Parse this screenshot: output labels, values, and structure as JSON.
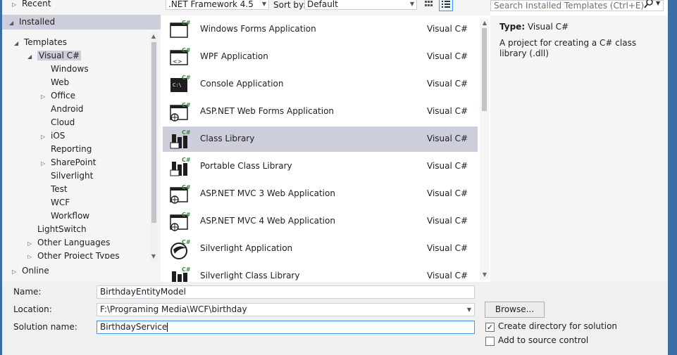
{
  "tree": {
    "recent": "Recent",
    "installed": "Installed",
    "templates": "Templates",
    "visual_csharp": "Visual C#",
    "children": [
      "Windows",
      "Web",
      "Office",
      "Android",
      "Cloud",
      "iOS",
      "Reporting",
      "SharePoint",
      "Silverlight",
      "Test",
      "WCF",
      "Workflow"
    ],
    "lightswitch": "LightSwitch",
    "other_languages": "Other Languages",
    "other_project_types": "Other Project Types",
    "online": "Online"
  },
  "toolbar": {
    "framework": ".NET Framework 4.5",
    "sort_label": "Sort by:",
    "sort_value": "Default",
    "search_placeholder": "Search Installed Templates (Ctrl+E)"
  },
  "templates": [
    {
      "name": "Windows Forms Application",
      "lang": "Visual C#",
      "icon": "windows-forms-icon"
    },
    {
      "name": "WPF Application",
      "lang": "Visual C#",
      "icon": "wpf-icon"
    },
    {
      "name": "Console Application",
      "lang": "Visual C#",
      "icon": "console-icon"
    },
    {
      "name": "ASP.NET Web Forms Application",
      "lang": "Visual C#",
      "icon": "web-forms-icon"
    },
    {
      "name": "Class Library",
      "lang": "Visual C#",
      "icon": "class-library-icon"
    },
    {
      "name": "Portable Class Library",
      "lang": "Visual C#",
      "icon": "portable-library-icon"
    },
    {
      "name": "ASP.NET MVC 3 Web Application",
      "lang": "Visual C#",
      "icon": "mvc-icon"
    },
    {
      "name": "ASP.NET MVC 4 Web Application",
      "lang": "Visual C#",
      "icon": "mvc-icon"
    },
    {
      "name": "Silverlight Application",
      "lang": "Visual C#",
      "icon": "silverlight-icon"
    },
    {
      "name": "Silverlight Class Library",
      "lang": "Visual C#",
      "icon": "silverlight-library-icon"
    }
  ],
  "selected_template": "Class Library",
  "description": {
    "type_label": "Type:",
    "type_value": "Visual C#",
    "text": "A project for creating a C# class library (.dll)"
  },
  "form": {
    "name_label": "Name:",
    "name_value": "BirthdayEntityModel",
    "location_label": "Location:",
    "location_value": "F:\\Programing Media\\WCF\\birthday",
    "solution_label": "Solution name:",
    "solution_value": "BirthdayService",
    "browse_label": "Browse...",
    "create_dir_label": "Create directory for solution",
    "create_dir_checked": true,
    "source_control_label": "Add to source control",
    "source_control_checked": false
  },
  "colors": {
    "selection": "#cccedb",
    "accent": "#3399ff",
    "window_frame": "#3a6ea5"
  }
}
